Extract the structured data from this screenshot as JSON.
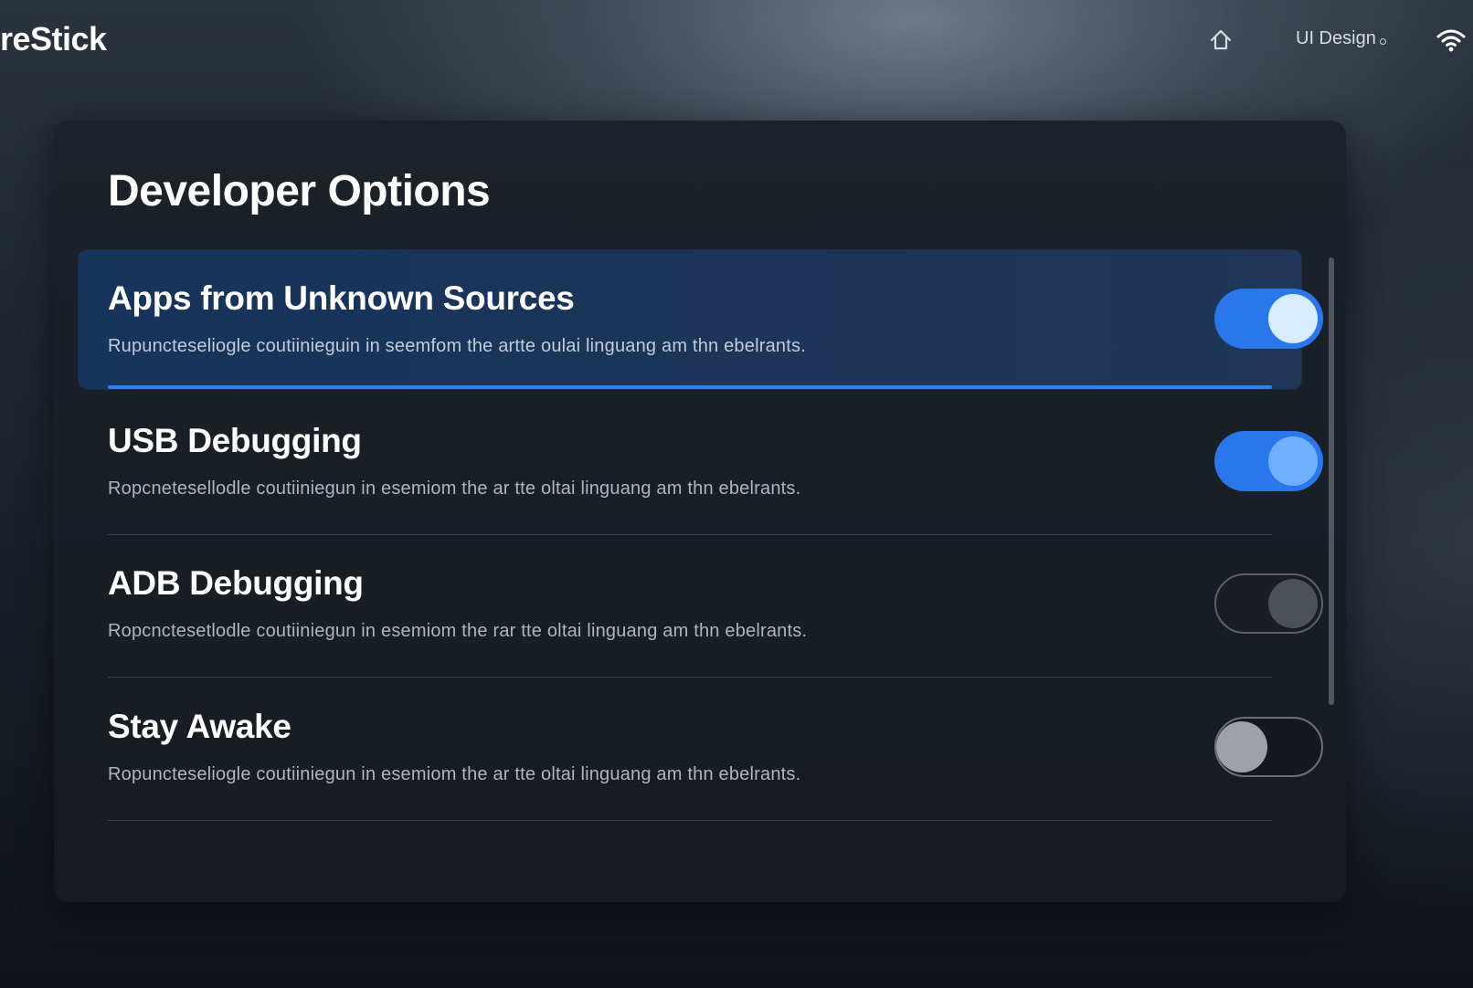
{
  "topbar": {
    "brand": "reStick",
    "menu_label": "UI Design",
    "icons": [
      "home-icon",
      "wifi-icon"
    ]
  },
  "panel": {
    "title": "Developer Options",
    "items": [
      {
        "label": "Apps from Unknown Sources",
        "description": "Rupuncteseliogle coutiinieguin in seemfom the artte oulai linguang am thn ebelrants.",
        "state": "on",
        "focused": true
      },
      {
        "label": "USB Debugging",
        "description": "Ropcnetesellodle coutiiniegun in esemiom the ar tte oltai linguang am thn ebelrants.",
        "state": "on",
        "focused": false
      },
      {
        "label": "ADB Debugging",
        "description": "Ropcnctesetlodle coutiiniegun in esemiom the rar tte oltai linguang am thn ebelrants.",
        "state": "off",
        "focused": false
      },
      {
        "label": "Stay Awake",
        "description": "Ropuncteseliogle coutiiniegun in esemiom the ar tte oltai linguang am thn ebelrants.",
        "state": "off",
        "focused": false
      }
    ]
  },
  "colors": {
    "accent": "#2a77ec",
    "focus_row": "#1b3558",
    "panel": "#1b2128"
  }
}
